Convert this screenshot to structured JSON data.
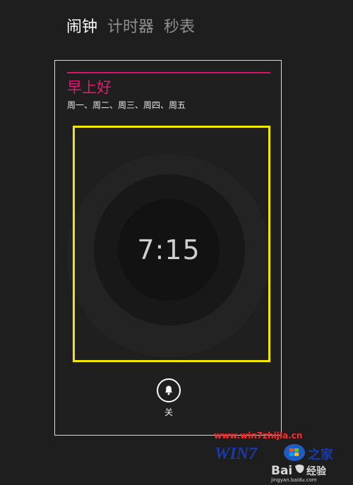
{
  "tabs": [
    {
      "label": "闹钟"
    },
    {
      "label": "计时器"
    },
    {
      "label": "秒表"
    }
  ],
  "alarm": {
    "name": "早上好",
    "days": "周一、周二、周三、周四、周五",
    "time": "7:15",
    "toggle_label": "关"
  },
  "watermark": {
    "site": "www.win7zhijia.cn",
    "logo_text": "WIN7之家",
    "baidu_text": "Bai 经验",
    "baidu_sub": "jingyan.baidu.com"
  },
  "colors": {
    "background": "#1e1e1e",
    "accent": "#e01a74",
    "highlight": "#f0e800"
  },
  "icons": {
    "toggle": "bell-icon"
  }
}
